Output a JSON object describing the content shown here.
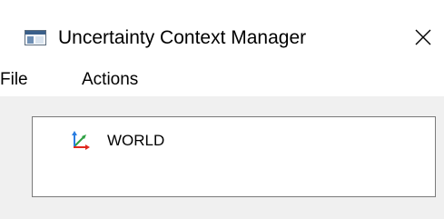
{
  "window": {
    "title": "Uncertainty Context Manager",
    "app_icon": "app-window-icon",
    "close_icon": "close-icon"
  },
  "menubar": {
    "items": [
      "File",
      "Actions"
    ]
  },
  "tree": {
    "items": [
      {
        "label": "WORLD",
        "icon": "coordinate-axes-icon"
      }
    ]
  },
  "colors": {
    "axis_x": "#e0281e",
    "axis_y": "#2a7de1",
    "axis_z": "#2ea043"
  }
}
